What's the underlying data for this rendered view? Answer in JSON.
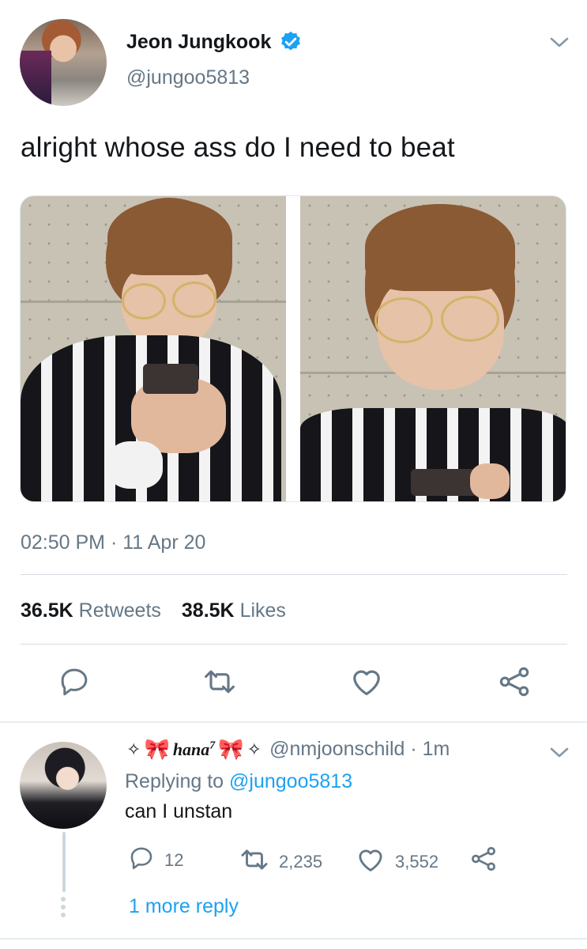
{
  "tweet": {
    "author_name": "Jeon Jungkook",
    "author_handle": "@jungoo5813",
    "text": "alright whose ass do I need to beat",
    "timestamp": "02:50 PM · 11 Apr 20",
    "retweets_value": "36.5K",
    "retweets_label": "Retweets",
    "likes_value": "38.5K",
    "likes_label": "Likes",
    "icons": [
      "verified-badge-icon",
      "chevron-down-icon",
      "reply-icon",
      "retweet-icon",
      "like-icon",
      "share-icon"
    ]
  },
  "reply": {
    "name_sparkle_left": "✧",
    "name_bow_left": "🎀",
    "name_text": "hana",
    "name_sup": "7",
    "name_bow_right": "🎀",
    "name_sparkle_right": "✧",
    "handle_time": "@nmjoonschild · 1m",
    "replying_prefix": "Replying to ",
    "replying_mention": "@jungoo5813",
    "text": "can I unstan",
    "reply_count": "12",
    "retweet_count": "2,235",
    "like_count": "3,552",
    "more_replies": "1 more reply"
  },
  "colors": {
    "accent": "#1da1f2",
    "secondary_text": "#657786",
    "primary_text": "#14171a",
    "divider": "#d6dde3"
  }
}
